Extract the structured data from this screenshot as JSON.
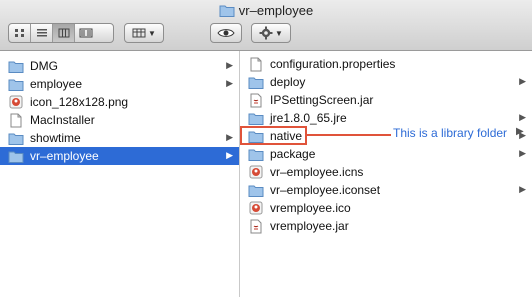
{
  "window": {
    "title": "vr–employee"
  },
  "toolbar": {
    "view_buttons": [
      "icon-view",
      "list-view",
      "column-view",
      "coverflow-view"
    ],
    "arrange_label": "arrange",
    "quicklook_label": "quick-look",
    "action_label": "action"
  },
  "columns": {
    "left": [
      {
        "name": "DMG",
        "type": "folder",
        "arrow": true,
        "selected": false
      },
      {
        "name": "employee",
        "type": "folder",
        "arrow": true,
        "selected": false
      },
      {
        "name": "icon_128x128.png",
        "type": "image",
        "arrow": false,
        "selected": false
      },
      {
        "name": "MacInstaller",
        "type": "file",
        "arrow": false,
        "selected": false
      },
      {
        "name": "showtime",
        "type": "folder",
        "arrow": true,
        "selected": false
      },
      {
        "name": "vr–employee",
        "type": "folder",
        "arrow": true,
        "selected": true
      }
    ],
    "right": [
      {
        "name": "configuration.properties",
        "type": "file",
        "arrow": false
      },
      {
        "name": "deploy",
        "type": "folder",
        "arrow": true
      },
      {
        "name": "IPSettingScreen.jar",
        "type": "jar",
        "arrow": false
      },
      {
        "name": "jre1.8.0_65.jre",
        "type": "folder",
        "arrow": true
      },
      {
        "name": "native",
        "type": "folder",
        "arrow": true
      },
      {
        "name": "package",
        "type": "folder",
        "arrow": true
      },
      {
        "name": "vr–employee.icns",
        "type": "icns",
        "arrow": false
      },
      {
        "name": "vr–employee.iconset",
        "type": "folder",
        "arrow": true
      },
      {
        "name": "vremployee.ico",
        "type": "image",
        "arrow": false
      },
      {
        "name": "vremployee.jar",
        "type": "jar",
        "arrow": false
      }
    ]
  },
  "annotation": {
    "text": "This is a library folder"
  },
  "colors": {
    "selection": "#2d6bd6",
    "annotation": "#e0533a",
    "annotation_text": "#2d6bd6"
  }
}
